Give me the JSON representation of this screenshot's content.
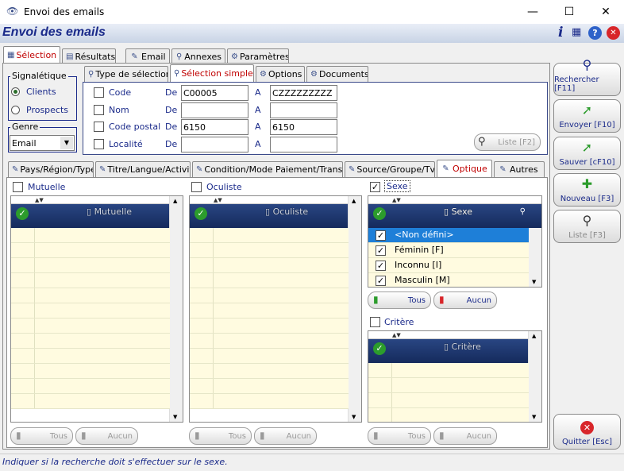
{
  "window": {
    "title": "Envoi des emails",
    "minimize": "—",
    "maximize": "☐",
    "close": "✕"
  },
  "header": {
    "title": "Envoi des emails",
    "info_icon": "i",
    "calc_icon": "▦",
    "help_icon": "?",
    "close_icon": "✕"
  },
  "main_tabs": [
    {
      "label": "Sélection"
    },
    {
      "label": "Résultats"
    },
    {
      "label": "Email"
    },
    {
      "label": "Annexes"
    },
    {
      "label": "Paramètres"
    }
  ],
  "signaletique": {
    "label": "Signalétique",
    "options": [
      {
        "label": "Clients",
        "checked": true
      },
      {
        "label": "Prospects",
        "checked": false
      }
    ]
  },
  "genre": {
    "label": "Genre",
    "value": "Email"
  },
  "sub_tabs": [
    {
      "label": "Type de sélection"
    },
    {
      "label": "Sélection simple"
    },
    {
      "label": "Options"
    },
    {
      "label": "Documents"
    }
  ],
  "criteria": {
    "de_label": "De",
    "a_label": "A",
    "rows": [
      {
        "label": "Code",
        "from": "C00005",
        "to": "CZZZZZZZZZ"
      },
      {
        "label": "Nom",
        "from": "",
        "to": ""
      },
      {
        "label": "Code postal",
        "from": "6150",
        "to": "6150"
      },
      {
        "label": "Localité",
        "from": "",
        "to": ""
      }
    ],
    "liste_button": "Liste [F2]"
  },
  "side_buttons": [
    {
      "label": "Rechercher [F11]",
      "icon": "⚲"
    },
    {
      "label": "Envoyer [F10]",
      "icon": "➚"
    },
    {
      "label": "Sauver [cF10]",
      "icon": "➚"
    },
    {
      "label": "Nouveau [F3]",
      "icon": "✚"
    },
    {
      "label": "Liste [F3]",
      "icon": "⚲"
    },
    {
      "label": "Quitter [Esc]",
      "icon": "✕"
    }
  ],
  "filter_tabs": [
    {
      "label": "Pays/Région/Type"
    },
    {
      "label": "Titre/Langue/Activité"
    },
    {
      "label": "Condition/Mode Paiement/Transport"
    },
    {
      "label": "Source/Groupe/Tva"
    },
    {
      "label": "Optique"
    },
    {
      "label": "Autres"
    }
  ],
  "lists": {
    "mutuelle": {
      "label": "Mutuelle",
      "checked": false,
      "column": "Mutuelle",
      "tous": "Tous",
      "aucun": "Aucun"
    },
    "oculiste": {
      "label": "Oculiste",
      "checked": false,
      "column": "Oculiste",
      "tous": "Tous",
      "aucun": "Aucun"
    },
    "sexe": {
      "label": "Sexe",
      "checked": true,
      "column": "Sexe",
      "tous": "Tous",
      "aucun": "Aucun",
      "items": [
        {
          "label": "<Non défini>",
          "checked": true
        },
        {
          "label": "Féminin [F]",
          "checked": true
        },
        {
          "label": "Inconnu [I]",
          "checked": true
        },
        {
          "label": "Masculin [M]",
          "checked": true
        }
      ]
    },
    "critere": {
      "label": "Critère",
      "checked": false,
      "column": "Critère",
      "tous": "Tous",
      "aucun": "Aucun"
    }
  },
  "status": "Indiquer si la recherche doit s'effectuer sur le sexe."
}
